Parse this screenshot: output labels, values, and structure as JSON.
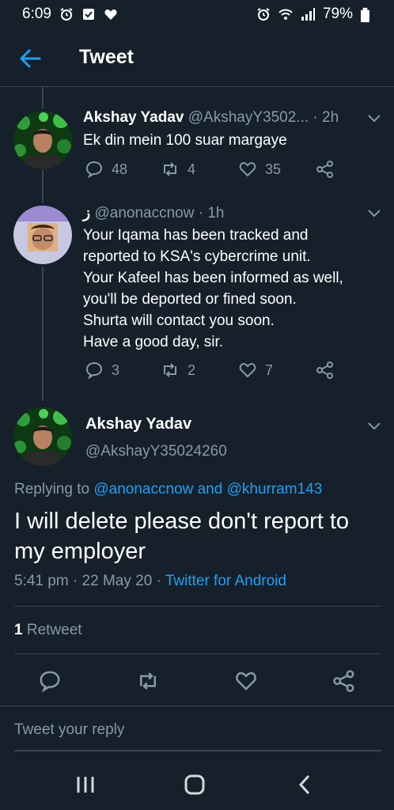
{
  "status_bar": {
    "time": "6:09",
    "battery": "79%",
    "left_icons": [
      "alarm-icon",
      "checkbox-icon",
      "heart-icon"
    ],
    "right_icons": [
      "alarm-icon",
      "wifi-icon",
      "signal-icon",
      "battery-icon"
    ]
  },
  "header": {
    "title": "Tweet",
    "back_icon": "arrow-left-icon"
  },
  "colors": {
    "background": "#15202b",
    "accent": "#1da1f2",
    "muted": "#8899a6",
    "divider": "#38444d"
  },
  "thread": [
    {
      "name": "Akshay Yadav",
      "handle": "@AkshayY3502...",
      "time": "· 2h",
      "text": "Ek din mein 100 suar margaye",
      "replies": "48",
      "retweets": "4",
      "likes": "35"
    },
    {
      "name": "ز",
      "handle": "@anonaccnow",
      "time": "· 1h",
      "lines": [
        "Your Iqama has been tracked and",
        "reported to KSA's cybercrime unit.",
        "Your Kafeel has been informed as well,",
        "you'll be deported or fined soon.",
        "Shurta will contact you soon.",
        "Have a good day, sir."
      ],
      "replies": "3",
      "retweets": "2",
      "likes": "7"
    }
  ],
  "main_tweet": {
    "name": "Akshay Yadav",
    "handle": "@AkshayY35024260",
    "replying_prefix": "Replying to",
    "replying_user1": "@anonaccnow",
    "replying_and": "and",
    "replying_user2": "@khurram143",
    "text_line1": "I will delete please don't report to",
    "text_line2": "my employer",
    "time": "5:41 pm",
    "date": "22 May 20",
    "source": "Twitter for Android",
    "retweet_count": "1",
    "retweet_label": "Retweet"
  },
  "reply_box": {
    "placeholder": "Tweet your reply"
  },
  "nav_bar": {
    "items": [
      "recent-apps-icon",
      "home-icon",
      "back-icon"
    ]
  }
}
